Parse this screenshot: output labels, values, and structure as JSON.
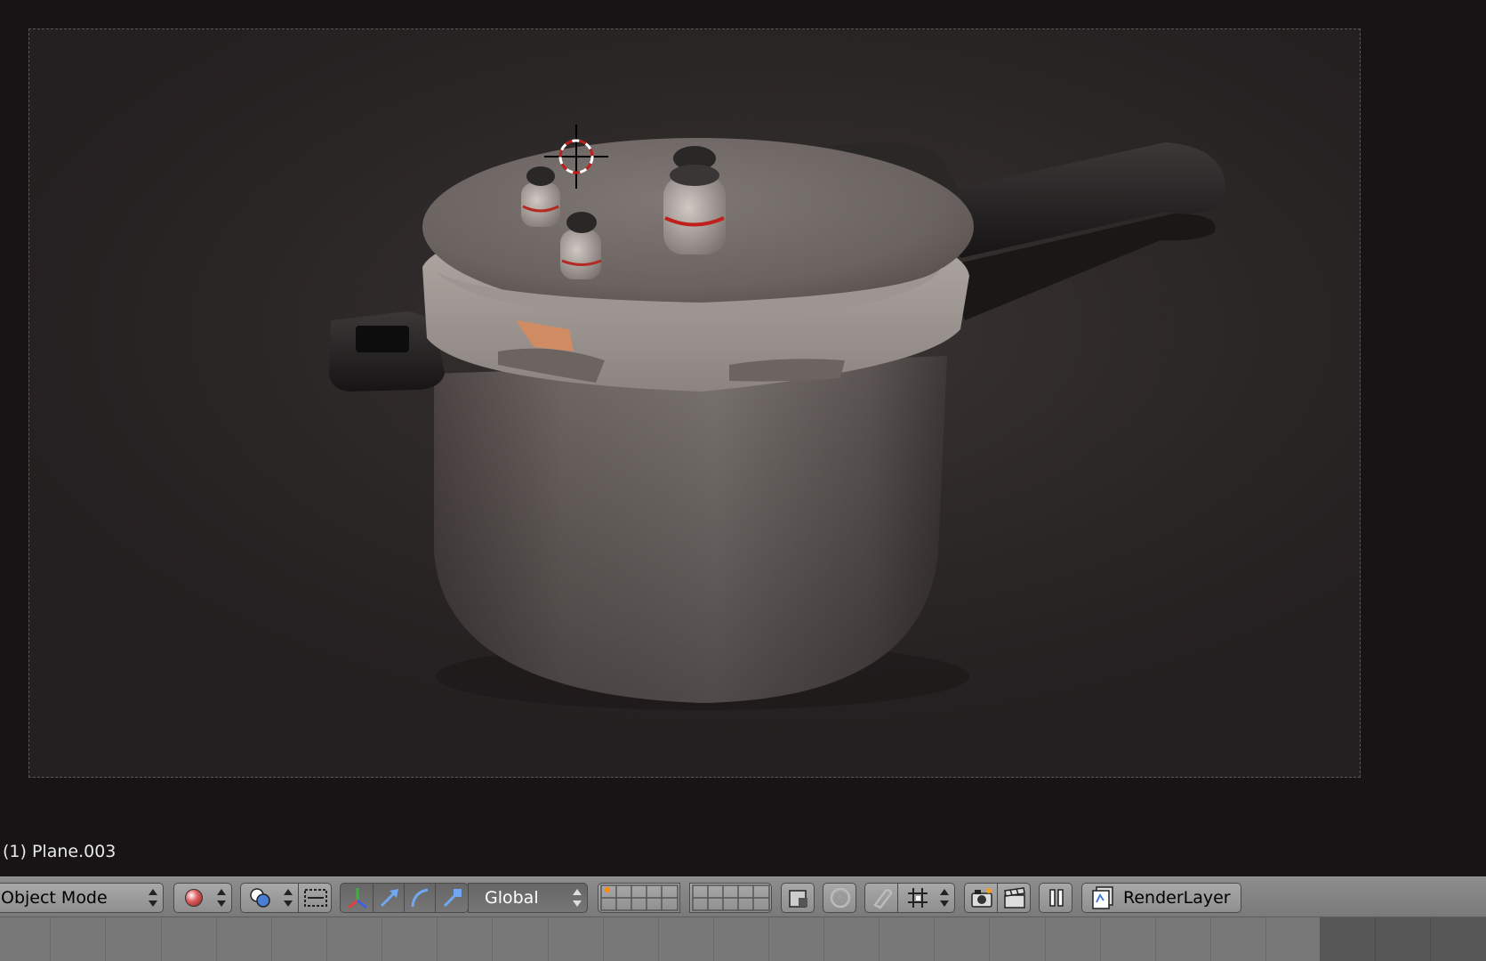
{
  "viewport": {
    "object_info": "(1) Plane.003"
  },
  "header": {
    "mode_label": "Object Mode",
    "viewport_shading_icon": "sphere-shading-icon",
    "pivot_icon": "pivot-point-icon",
    "manipulator_icons": [
      "transform-manipulator-icon",
      "translate-icon",
      "rotate-icon",
      "scale-icon"
    ],
    "orientation_label": "Global",
    "layers_icon": "layer-grid-icon",
    "snap_icons": [
      "lock-camera-icon",
      "proportional-edit-icon",
      "magnet-icon",
      "snap-element-icon"
    ],
    "render_icons": [
      "opengl-render-icon",
      "opengl-animation-icon"
    ],
    "pause_icon": "pause-icon",
    "render_layer_label": "RenderLayer"
  },
  "colors": {
    "viewport_bg": "#171416",
    "header_bg": "#8d8d8d",
    "accent_red": "#c0201d",
    "active_layer": "#ff8a00"
  }
}
